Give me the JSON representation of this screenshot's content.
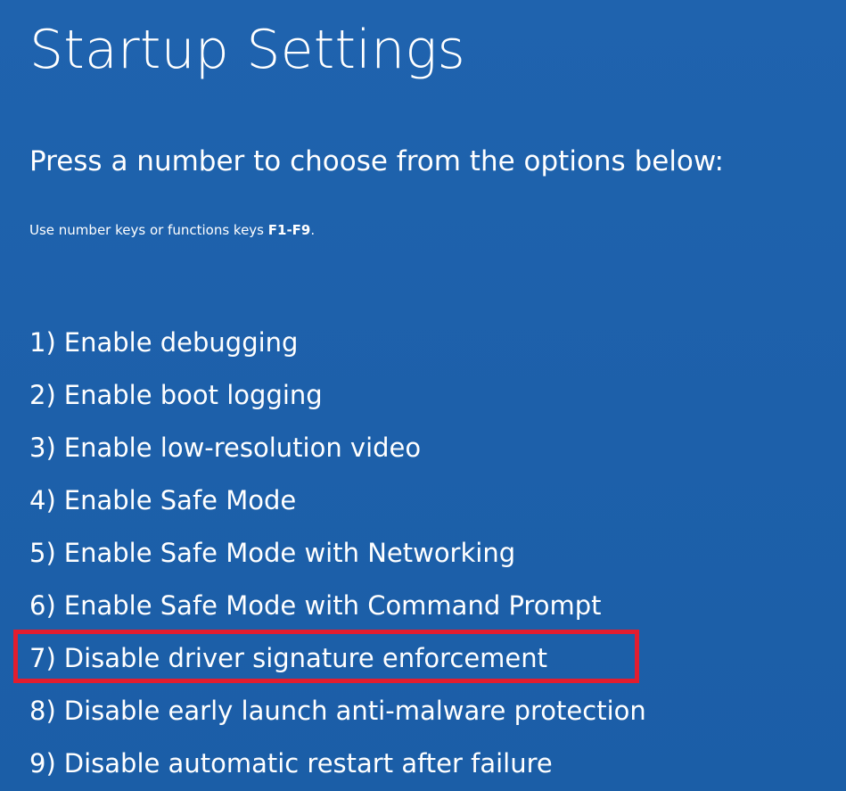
{
  "screen": {
    "title": "Startup Settings",
    "subtitle": "Press a number to choose from the options below:",
    "hint_prefix": "Use number keys or functions keys ",
    "hint_keys": "F1-F9",
    "hint_suffix": "."
  },
  "options": [
    {
      "number": "1)",
      "label": "Enable debugging",
      "highlighted": false
    },
    {
      "number": "2)",
      "label": "Enable boot logging",
      "highlighted": false
    },
    {
      "number": "3)",
      "label": "Enable low-resolution video",
      "highlighted": false
    },
    {
      "number": "4)",
      "label": "Enable Safe Mode",
      "highlighted": false
    },
    {
      "number": "5)",
      "label": "Enable Safe Mode with Networking",
      "highlighted": false
    },
    {
      "number": "6)",
      "label": "Enable Safe Mode with Command Prompt",
      "highlighted": false
    },
    {
      "number": "7)",
      "label": "Disable driver signature enforcement",
      "highlighted": true
    },
    {
      "number": "8)",
      "label": "Disable early launch anti-malware protection",
      "highlighted": false
    },
    {
      "number": "9)",
      "label": "Disable automatic restart after failure",
      "highlighted": false
    }
  ],
  "colors": {
    "background": "#1e62ad",
    "text": "#ffffff",
    "highlight_border": "#e21d2f"
  }
}
